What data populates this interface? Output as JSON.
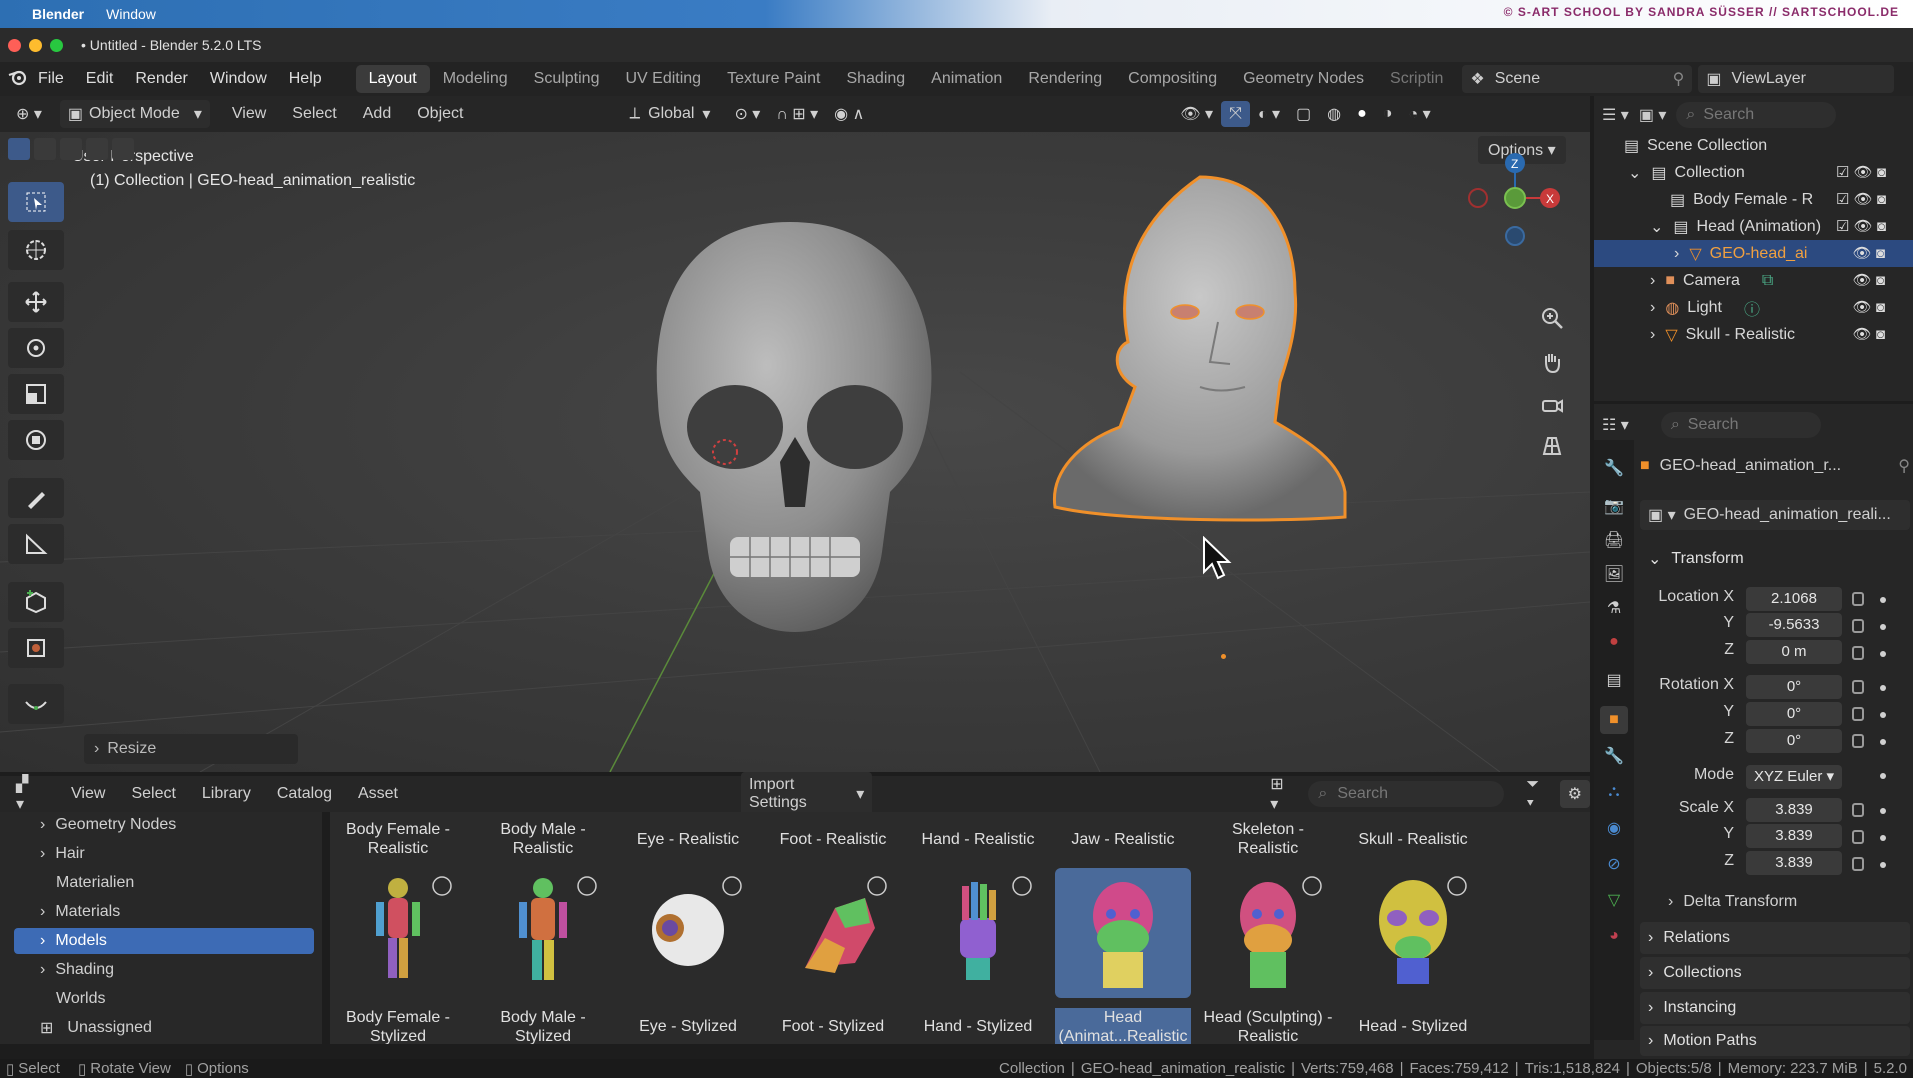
{
  "macos": {
    "app": "Blender",
    "menu_window": "Window",
    "credit": "© S-ART SCHOOL BY SANDRA SÜSSER // SARTSCHOOL.DE"
  },
  "window": {
    "title": "• Untitled - Blender 5.2.0 LTS"
  },
  "topbar": {
    "menus": [
      "File",
      "Edit",
      "Render",
      "Window",
      "Help"
    ],
    "workspaces": [
      "Layout",
      "Modeling",
      "Sculpting",
      "UV Editing",
      "Texture Paint",
      "Shading",
      "Animation",
      "Rendering",
      "Compositing",
      "Geometry Nodes",
      "Scriptin"
    ],
    "active_workspace": "Layout",
    "scene": "Scene",
    "view_layer": "ViewLayer"
  },
  "viewport_header": {
    "mode": "Object Mode",
    "menus": [
      "View",
      "Select",
      "Add",
      "Object"
    ],
    "transform_orientation": "Global",
    "options": "Options"
  },
  "viewport": {
    "perspective": "User Perspective",
    "collection_info": "(1) Collection | GEO-head_animation_realistic",
    "gizmo": {
      "z": "Z",
      "x": "X"
    },
    "last_op": "Resize"
  },
  "outliner": {
    "search_placeholder": "Search",
    "root": "Scene Collection",
    "items": [
      {
        "label": "Collection"
      },
      {
        "label": "Body Female - R"
      },
      {
        "label": "Head (Animation)"
      },
      {
        "label": "GEO-head_ai"
      },
      {
        "label": "Camera"
      },
      {
        "label": "Light"
      },
      {
        "label": "Skull - Realistic"
      }
    ]
  },
  "properties": {
    "search_placeholder": "Search",
    "object_name": "GEO-head_animation_r...",
    "data_name": "GEO-head_animation_reali...",
    "transform_label": "Transform",
    "location_label": "Location X",
    "rotation_label": "Rotation X",
    "scale_label": "Scale X",
    "mode_label": "Mode",
    "y": "Y",
    "z": "Z",
    "location": [
      "2.1068",
      "-9.5633",
      "0 m"
    ],
    "rotation": [
      "0°",
      "0°",
      "0°"
    ],
    "rotation_mode": "XYZ Euler",
    "scale": [
      "3.839",
      "3.839",
      "3.839"
    ],
    "sections": [
      "Delta Transform",
      "Relations",
      "Collections",
      "Instancing",
      "Motion Paths"
    ]
  },
  "asset_browser": {
    "menus": [
      "View",
      "Select",
      "Library",
      "Catalog",
      "Asset"
    ],
    "import_settings": "Import Settings",
    "search_placeholder": "Search",
    "catalogs": [
      "Geometry Nodes",
      "Hair",
      "Materialien",
      "Materials",
      "Models",
      "Shading",
      "Worlds",
      "Unassigned"
    ],
    "active_catalog": "Models",
    "row1": [
      "Body Female - Realistic",
      "Body Male - Realistic",
      "Eye - Realistic",
      "Foot - Realistic",
      "Hand - Realistic",
      "Jaw - Realistic",
      "Skeleton - Realistic",
      "Skull - Realistic"
    ],
    "row2": [
      "Body Female - Stylized",
      "Body Male - Stylized",
      "Eye - Stylized",
      "Foot - Stylized",
      "Hand - Stylized",
      "Head (Animat...Realistic",
      "Head (Sculpting) - Realistic",
      "Head - Stylized"
    ],
    "selected_asset": "Head (Animat...Realistic"
  },
  "statusbar": {
    "left": [
      "Select",
      "Rotate View",
      "Options"
    ],
    "collection": "Collection",
    "object": "GEO-head_animation_realistic",
    "verts": "Verts:759,468",
    "faces": "Faces:759,412",
    "tris": "Tris:1,518,824",
    "objects": "Objects:5/8",
    "memory": "Memory: 223.7 MiB",
    "version": "5.2.0"
  },
  "colors": {
    "accent": "#3d6bb5",
    "selection_outline": "#f0902a",
    "active_tool": "#3d5a8a"
  }
}
